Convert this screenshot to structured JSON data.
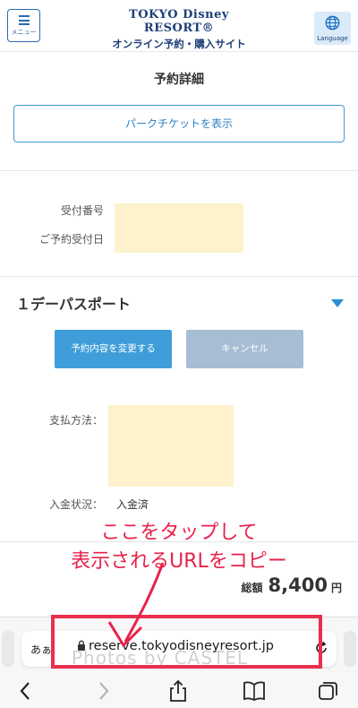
{
  "header": {
    "menu_label": "メニュー",
    "logo_line1": "TOKYO Disney RESORT®",
    "logo_line2": "オンライン予約・購入サイト",
    "language_label": "Language"
  },
  "page": {
    "title": "予約詳細",
    "park_ticket_button": "パークチケットを表示",
    "reception_number_label": "受付番号",
    "reception_date_label": "ご予約受付日"
  },
  "ticket": {
    "title": "１デーパスポート",
    "change_button": "予約内容を変更する",
    "cancel_button": "キャンセル",
    "payment_label": "支払方法：",
    "payment_status_label": "入金状況：",
    "payment_status_value": "入金済"
  },
  "annotation": {
    "line1": "ここをタップして",
    "line2": "表示されるURLをコピー"
  },
  "total": {
    "label": "総額",
    "amount": "8,400",
    "unit": "円"
  },
  "browser": {
    "aa_label": "あぁ",
    "url": "reserve.tokyodisneyresort.jp",
    "watermark": "Photos by CASTEL"
  },
  "colors": {
    "brand_navy": "#1d3f77",
    "accent_blue": "#3f9ed9",
    "annotation_red": "#e8224b",
    "mask_yellow": "#fdf2cc"
  },
  "icons": [
    "menu-icon",
    "globe-icon",
    "triangle-down-icon",
    "lock-icon",
    "reload-icon",
    "back-icon",
    "forward-icon",
    "share-icon",
    "bookmarks-icon",
    "tabs-icon"
  ]
}
